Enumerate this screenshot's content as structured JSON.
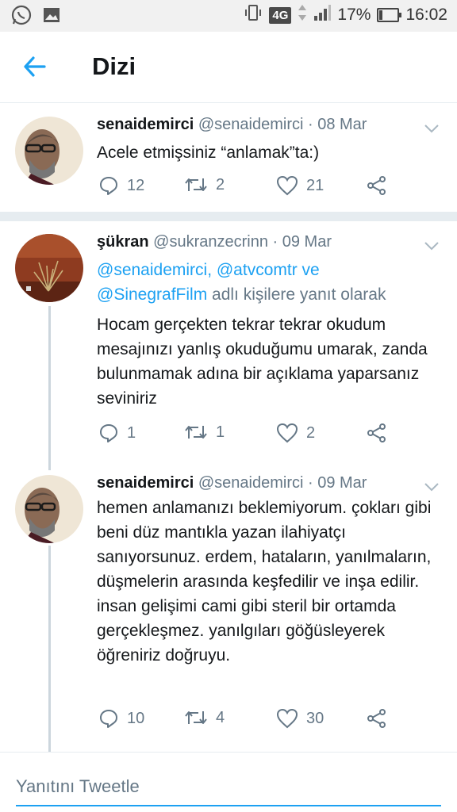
{
  "status_bar": {
    "network": "4G",
    "battery": "17%",
    "battery_level": 0.17,
    "time": "16:02",
    "icons": [
      "whatsapp-icon",
      "gallery-icon",
      "vibrate-icon",
      "signal-icon",
      "battery-icon"
    ]
  },
  "header": {
    "title": "Dizi",
    "back_icon": "arrow-left-icon"
  },
  "tweets": [
    {
      "name": "senaidemirci",
      "handle": "@senaidemirci",
      "date": "· 08 Mar",
      "text": "Acele etmişsiniz “anlamak”ta:)",
      "replies": "12",
      "retweets": "2",
      "likes": "21"
    },
    {
      "name": "şükran",
      "handle": "@sukranzecrinn",
      "date": "· 09 Mar",
      "reply_links_1": "@senaidemirci, @atvcomtr ve",
      "reply_links_2": "@SinegrafFilm",
      "reply_suffix": " adlı kişilere yanıt olarak",
      "text": "Hocam gerçekten tekrar tekrar okudum mesajınızı  yanlış okuduğumu umarak, zanda bulunmamak adına bir açıklama yaparsanız seviniriz",
      "replies": "1",
      "retweets": "1",
      "likes": "2"
    },
    {
      "name": "senaidemirci",
      "handle": "@senaidemirci",
      "date": "· 09 Mar",
      "text": "hemen anlamanızı beklemiyorum. çokları gibi beni düz mantıkla yazan ilahiyatçı sanıyorsunuz. erdem, hataların, yanılmaların, düşmelerin arasında keşfedilir ve inşa edilir. insan gelişimi cami gibi steril bir ortamda gerçekleşmez. yanılgıları göğüsleyerek öğreniriz doğruyu.",
      "replies": "10",
      "retweets": "4",
      "likes": "30"
    }
  ],
  "reply_bar": {
    "placeholder": "Yanıtını Tweetle"
  },
  "colors": {
    "accent": "#1da1f2",
    "secondary_text": "#657786",
    "divider": "#e6ecf0"
  }
}
